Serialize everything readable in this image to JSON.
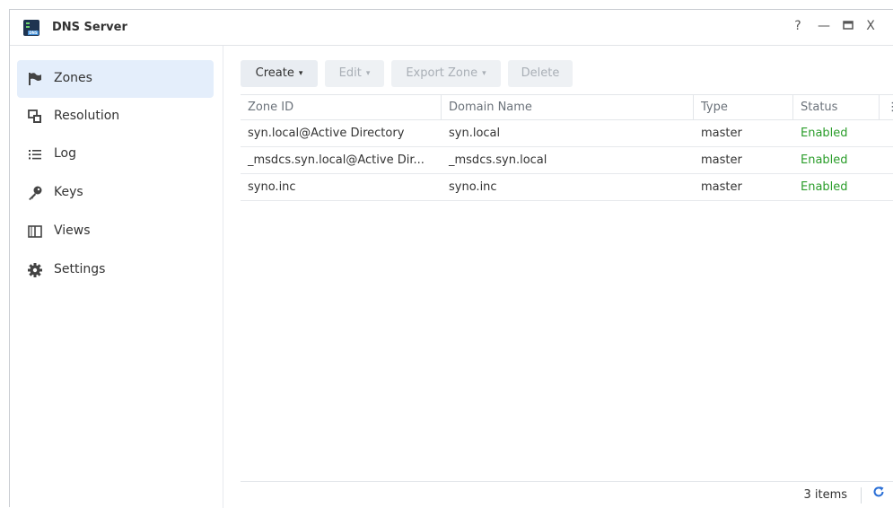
{
  "window": {
    "title": "DNS Server",
    "app_icon": "dns-server-app-icon",
    "controls": {
      "help": "?",
      "minimize": "—",
      "maximize": "▭",
      "close": "X"
    }
  },
  "sidebar": {
    "items": [
      {
        "label": "Zones",
        "icon": "flag-icon",
        "active": true
      },
      {
        "label": "Resolution",
        "icon": "resolution-icon",
        "active": false
      },
      {
        "label": "Log",
        "icon": "list-icon",
        "active": false
      },
      {
        "label": "Keys",
        "icon": "key-icon",
        "active": false
      },
      {
        "label": "Views",
        "icon": "book-icon",
        "active": false
      },
      {
        "label": "Settings",
        "icon": "gear-icon",
        "active": false
      }
    ]
  },
  "toolbar": {
    "create": "Create",
    "edit": "Edit",
    "export_zone": "Export Zone",
    "delete": "Delete"
  },
  "table": {
    "columns": [
      "Zone ID",
      "Domain Name",
      "Type",
      "Status"
    ],
    "rows": [
      {
        "zone_id": "syn.local@Active Directory",
        "domain": "syn.local",
        "type": "master",
        "status": "Enabled"
      },
      {
        "zone_id": "_msdcs.syn.local@Active Dir...",
        "domain": "_msdcs.syn.local",
        "type": "master",
        "status": "Enabled"
      },
      {
        "zone_id": "syno.inc",
        "domain": "syno.inc",
        "type": "master",
        "status": "Enabled"
      }
    ]
  },
  "footer": {
    "count": "3 items"
  },
  "colors": {
    "accent": "#2a6fd6",
    "enabled": "#2a9d2a",
    "active_nav": "#e4eefb"
  }
}
